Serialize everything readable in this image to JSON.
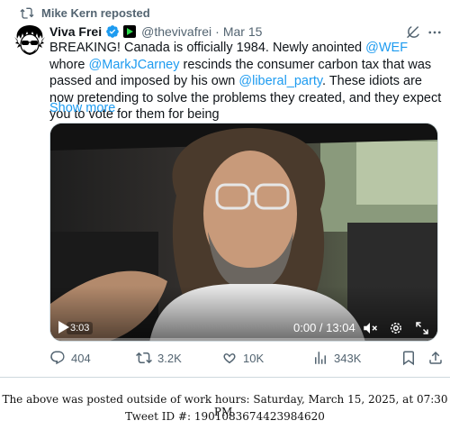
{
  "repost": {
    "text": "Mike Kern reposted"
  },
  "author": {
    "name": "Viva Frei",
    "handle": "@thevivafrei",
    "separator": "·",
    "date": "Mar 15"
  },
  "tweet": {
    "t1": "BREAKING! Canada is officially 1984. Newly anointed ",
    "m1": "@WEF",
    "t2": " whore ",
    "m2": "@MarkJCarney",
    "t3": " rescinds the consumer carbon tax that was passed and imposed by his own ",
    "m3": "@liberal_party",
    "t4": ". These idiots are now pretending to solve the problems they created, and they expect you to vote for them for being",
    "show_more": "Show more"
  },
  "video": {
    "elapsed_badge": "3:03",
    "time": "0:00 / 13:04"
  },
  "actions": {
    "replies": "404",
    "reposts": "3.2K",
    "likes": "10K",
    "views": "343K"
  },
  "footer": {
    "line1": "The above was posted outside of work hours: Saturday, March 15, 2025, at 07:30 PM.",
    "line2": "Tweet ID #: 1901083674423984620"
  },
  "colors": {
    "link": "#1d9bf0",
    "secondary_text": "#536471",
    "verified": "#1d9bf0"
  }
}
